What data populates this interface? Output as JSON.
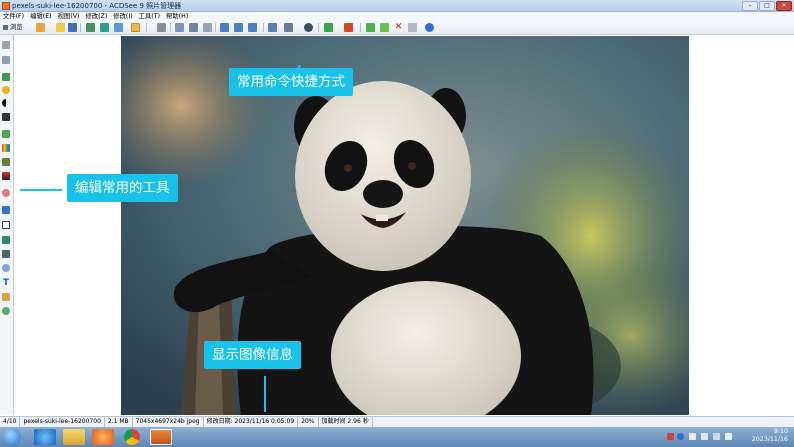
{
  "window": {
    "title": "pexels-suki-lee-16200700 - ACDSee 9 照片管理器",
    "controls": [
      "–",
      "□",
      "✕"
    ]
  },
  "menu": [
    "文件(F)",
    "编辑(E)",
    "视图(V)",
    "修改(Z)",
    "修改(I)",
    "工具(T)",
    "帮助(H)"
  ],
  "toolbar": {
    "browse_label": "浏览"
  },
  "callouts": {
    "toolbar_shortcuts": "常用命令快捷方式",
    "editing_tools": "编辑常用的工具",
    "image_info": "显示图像信息"
  },
  "statusbar": {
    "position": "4/10",
    "filename": "pexels-suki-lee-16200700",
    "filesize": "2.1 MB",
    "dimensions": "7045x4697x24b jpeg",
    "modified": "修改日期: 2023/11/16 0:05:09",
    "zoom": "20%",
    "load_time": "加载时间 2.96 秒"
  },
  "taskbar": {
    "time": "9:10",
    "date": "2023/11/16"
  },
  "colors": {
    "callout": "#18c2e9",
    "toolbar_highlight": "#f0b450"
  },
  "icons": {
    "toolbar": [
      "browse-icon",
      "rotate-icon",
      "open-folder-icon",
      "save-icon",
      "print-icon",
      "slideshow-icon",
      "copy-icon",
      "hand-icon",
      "zoom-icon",
      "fit-window-icon",
      "full-screen-icon",
      "actual-size-icon",
      "zoom-in-icon",
      "zoom-out-icon",
      "zoom-dropdown-icon",
      "paint-bucket-icon",
      "brightness-icon",
      "circle-icon",
      "color-mode-icon",
      "red-eye-icon",
      "green-arrow-icon",
      "arrow-right-icon",
      "delete-icon",
      "properties-icon",
      "help-icon"
    ],
    "left_tools": [
      "crop-icon",
      "resize-icon",
      "image-icon",
      "sun-icon",
      "contrast-icon",
      "levels-icon",
      "color-icon",
      "histogram-icon",
      "layers-icon",
      "gradient-icon",
      "red-eye-tool-icon",
      "sharpen-icon",
      "frame-icon",
      "photo-fix-icon",
      "rotate-tool-icon",
      "text-icon",
      "brush-icon",
      "effects-icon"
    ],
    "taskbar": [
      "start-icon",
      "ie-icon",
      "explorer-icon",
      "media-player-icon",
      "chrome-icon",
      "acdsee-icon"
    ]
  }
}
